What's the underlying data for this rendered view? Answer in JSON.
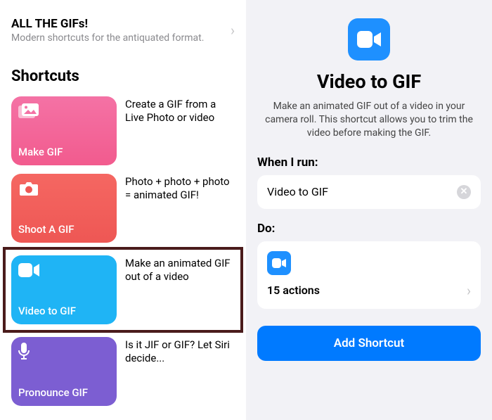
{
  "gallery": {
    "title": "ALL THE GIFs!",
    "subtitle": "Modern shortcuts for the antiquated format."
  },
  "section_title": "Shortcuts",
  "shortcuts": [
    {
      "name": "Make GIF",
      "desc": "Create a GIF from a Live Photo or video"
    },
    {
      "name": "Shoot A GIF",
      "desc": "Photo + photo + photo = animated GIF!"
    },
    {
      "name": "Video to GIF",
      "desc": "Make an animated GIF out of a video"
    },
    {
      "name": "Pronounce GIF",
      "desc": "Is it JIF or GIF? Let Siri decide..."
    }
  ],
  "detail": {
    "title": "Video to GIF",
    "desc": "Make an animated GIF out of a video in your camera roll. This shortcut allows you to trim the video before making the GIF.",
    "when_label": "When I run:",
    "when_value": "Video to GIF",
    "do_label": "Do:",
    "actions": "15 actions",
    "add_button": "Add Shortcut"
  }
}
